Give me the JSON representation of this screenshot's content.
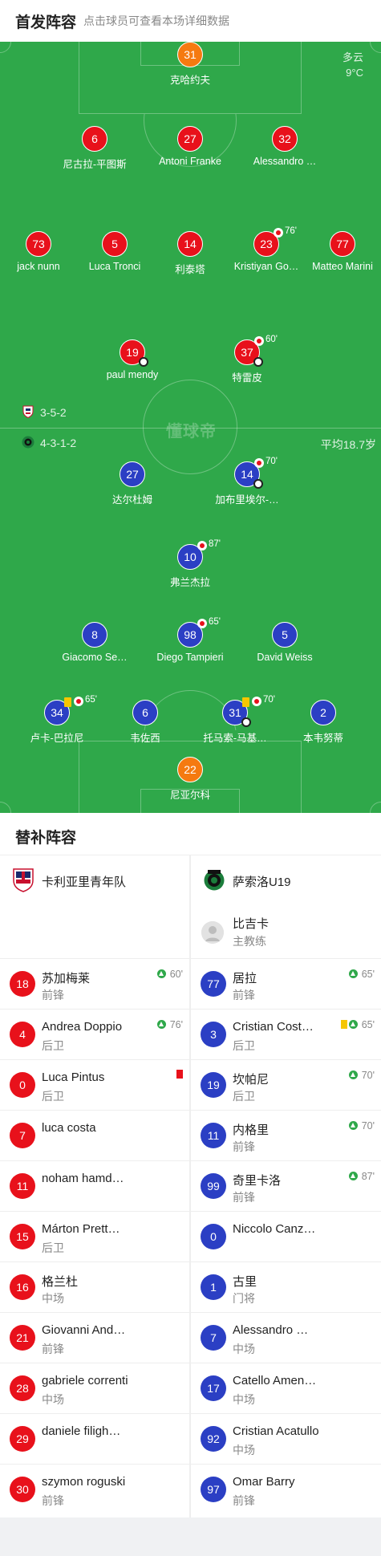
{
  "header": {
    "title": "首发阵容",
    "subtitle": "点击球员可查看本场详细数据"
  },
  "weather": {
    "condition": "多云",
    "temp": "9°C"
  },
  "watermark": "懂球帝",
  "home": {
    "formation": "3-5-2"
  },
  "away": {
    "formation": "4-3-1-2",
    "avg_age": "平均18.7岁"
  },
  "home_players": [
    {
      "num": "31",
      "name": "克哈约夫",
      "color": "orange"
    },
    {
      "num": "6",
      "name": "尼古拉-平图斯",
      "color": "red"
    },
    {
      "num": "27",
      "name": "Antoni Franke",
      "color": "red"
    },
    {
      "num": "32",
      "name": "Alessandro …",
      "color": "red"
    },
    {
      "num": "73",
      "name": "jack nunn",
      "color": "red"
    },
    {
      "num": "5",
      "name": "Luca Tronci",
      "color": "red"
    },
    {
      "num": "14",
      "name": "利泰塔",
      "color": "red"
    },
    {
      "num": "23",
      "name": "Kristiyan Go…",
      "color": "red",
      "sub": "76'"
    },
    {
      "num": "77",
      "name": "Matteo Marini",
      "color": "red"
    },
    {
      "num": "19",
      "name": "paul mendy",
      "color": "red"
    },
    {
      "num": "37",
      "name": "特雷皮",
      "color": "red",
      "sub": "60'"
    }
  ],
  "away_players": [
    {
      "num": "27",
      "name": "达尔杜姆",
      "color": "blue"
    },
    {
      "num": "14",
      "name": "加布里埃尔-…",
      "color": "blue",
      "sub": "70'"
    },
    {
      "num": "10",
      "name": "弗兰杰拉",
      "color": "blue",
      "sub": "87'"
    },
    {
      "num": "8",
      "name": "Giacomo Se…",
      "color": "blue"
    },
    {
      "num": "98",
      "name": "Diego Tampieri",
      "color": "blue",
      "sub": "65'"
    },
    {
      "num": "5",
      "name": "David Weiss",
      "color": "blue"
    },
    {
      "num": "34",
      "name": "卢卡-巴拉尼",
      "color": "blue",
      "sub": "65'"
    },
    {
      "num": "6",
      "name": "韦佐西",
      "color": "blue"
    },
    {
      "num": "31",
      "name": "托马索-马基…",
      "color": "blue",
      "sub": "70'"
    },
    {
      "num": "2",
      "name": "本韦努蒂",
      "color": "blue"
    },
    {
      "num": "22",
      "name": "尼亚尔科",
      "color": "orange"
    }
  ],
  "subs": {
    "title": "替补阵容",
    "home_team": "卡利亚里青年队",
    "away_team": "萨索洛U19",
    "away_coach": {
      "name": "比吉卡",
      "role": "主教练"
    },
    "home": [
      {
        "num": "18",
        "name": "苏加梅莱",
        "pos": "前锋",
        "info": "60'"
      },
      {
        "num": "4",
        "name": "Andrea Doppio",
        "pos": "后卫",
        "info": "76'"
      },
      {
        "num": "0",
        "name": "Luca Pintus",
        "pos": "后卫",
        "info": ""
      },
      {
        "num": "7",
        "name": "luca costa",
        "pos": "",
        "info": ""
      },
      {
        "num": "11",
        "name": "noham hamd…",
        "pos": "",
        "info": ""
      },
      {
        "num": "15",
        "name": "Márton Prette…",
        "pos": "后卫",
        "info": ""
      },
      {
        "num": "16",
        "name": "格兰杜",
        "pos": "中场",
        "info": ""
      },
      {
        "num": "21",
        "name": "Giovanni And…",
        "pos": "前锋",
        "info": ""
      },
      {
        "num": "28",
        "name": "gabriele correnti",
        "pos": "中场",
        "info": ""
      },
      {
        "num": "29",
        "name": "daniele filighe…",
        "pos": "",
        "info": ""
      },
      {
        "num": "30",
        "name": "szymon roguski",
        "pos": "前锋",
        "info": ""
      }
    ],
    "away": [
      {
        "num": "77",
        "name": "居拉",
        "pos": "前锋",
        "info": "65'"
      },
      {
        "num": "3",
        "name": "Cristian Cost…",
        "pos": "后卫",
        "info": "65'"
      },
      {
        "num": "19",
        "name": "坎帕尼",
        "pos": "后卫",
        "info": "70'"
      },
      {
        "num": "11",
        "name": "内格里",
        "pos": "前锋",
        "info": "70'"
      },
      {
        "num": "99",
        "name": "奇里卡洛",
        "pos": "前锋",
        "info": "87'"
      },
      {
        "num": "0",
        "name": "Niccolo Canzi…",
        "pos": "",
        "info": ""
      },
      {
        "num": "1",
        "name": "古里",
        "pos": "门将",
        "info": ""
      },
      {
        "num": "7",
        "name": "Alessandro C…",
        "pos": "中场",
        "info": ""
      },
      {
        "num": "17",
        "name": "Catello Amen…",
        "pos": "中场",
        "info": ""
      },
      {
        "num": "92",
        "name": "Cristian Acatullo",
        "pos": "中场",
        "info": ""
      },
      {
        "num": "97",
        "name": "Omar Barry",
        "pos": "前锋",
        "info": ""
      }
    ]
  }
}
